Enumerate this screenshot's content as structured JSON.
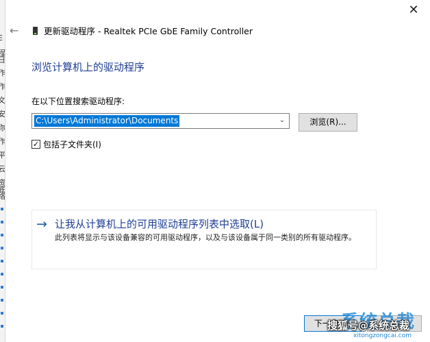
{
  "background_window": {
    "glyphs": [
      "E",
      "程",
      "日",
      "作",
      "作",
      "文",
      "安",
      "你",
      "作",
      "平",
      "云",
      "资",
      "底",
      "络"
    ]
  },
  "dialog": {
    "title": "更新驱动程序 - Realtek PCIe GbE Family Controller",
    "close_icon": "✕",
    "back_icon": "←",
    "heading": "浏览计算机上的驱动程序",
    "search_label": "在以下位置搜索驱动程序:",
    "path_value": "C:\\Users\\Administrator\\Documents",
    "combo_arrow": "⌵",
    "browse_label": "浏览(R)...",
    "include_subfolders_label": "包括子文件夹(I)",
    "include_subfolders_checked": true,
    "check_mark": "✓",
    "pick_arrow": "→",
    "pick_title": "让我从计算机上的可用驱动程序列表中选取(L)",
    "pick_description": "此列表将显示与该设备兼容的可用驱动程序，以及与该设备属于同一类别的所有驱动程序。",
    "next_label": "下一步(N)"
  },
  "watermark": {
    "text": "搜狐号@系统总裁",
    "logo": "系统总裁",
    "domain": "xitongzongcai.com"
  },
  "colors": {
    "accent": "#0078d7",
    "heading": "#1f3e94",
    "button_face": "#e1e1e1"
  }
}
